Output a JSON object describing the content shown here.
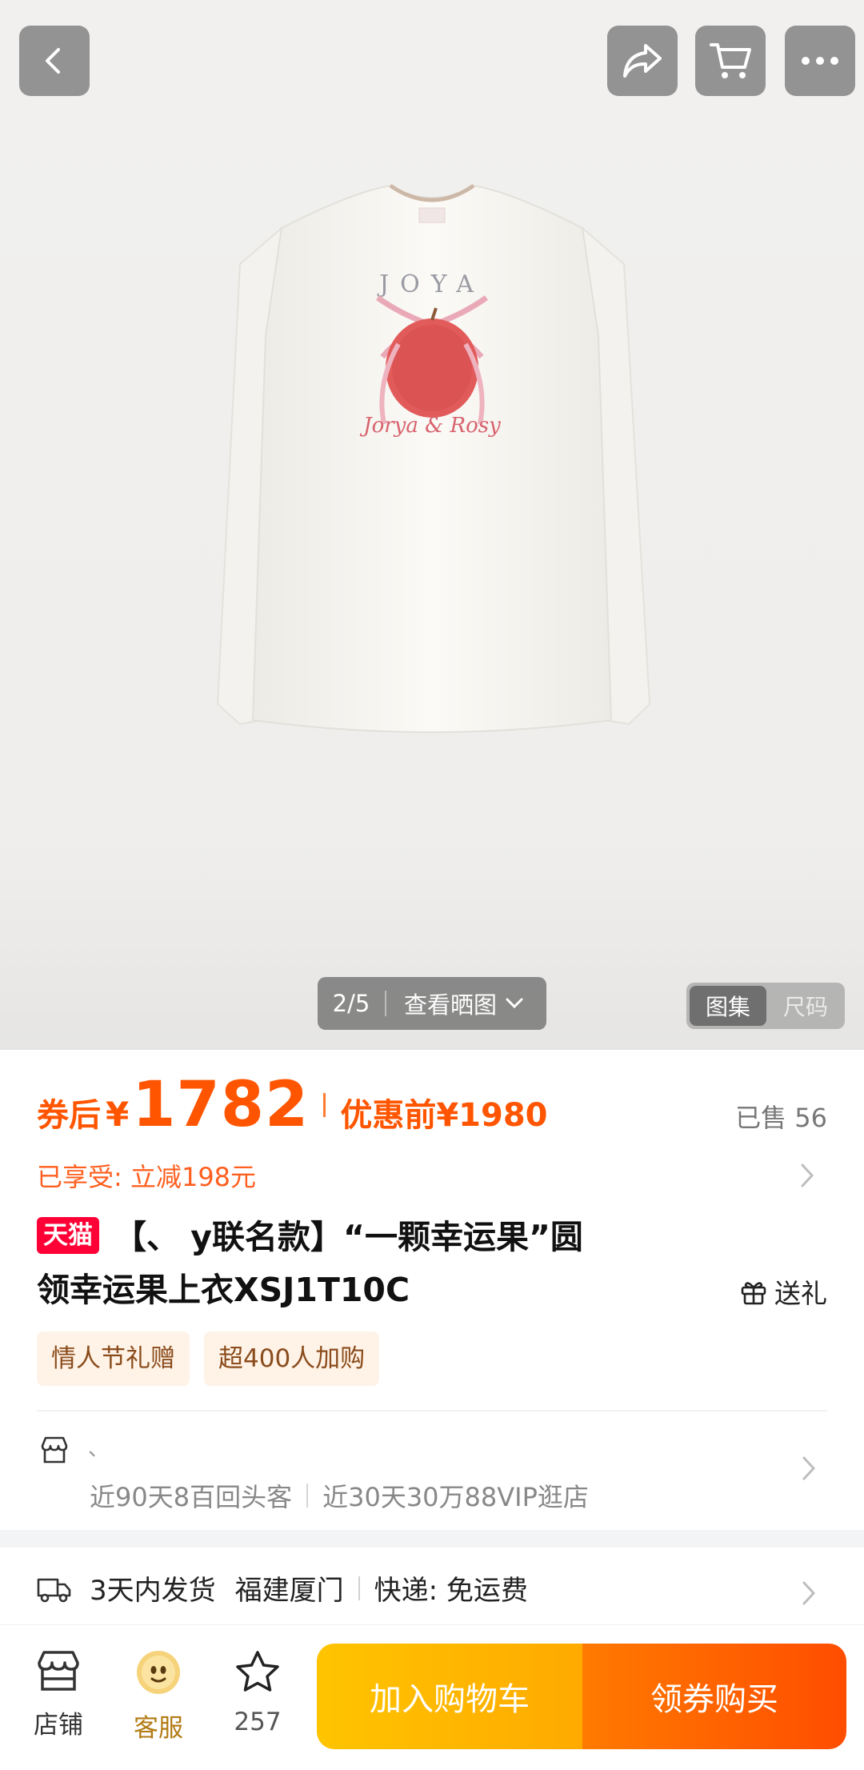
{
  "gallery": {
    "counter": "2/5",
    "view_label": "查看晒图",
    "segment_active": "图集",
    "segment_inactive": "尺码",
    "shirt_print_brand": "JOYA",
    "shirt_print_script": "Jorya & Rosy"
  },
  "price": {
    "after_label": "券后",
    "currency": "¥",
    "after_value": "1782",
    "before_label": "优惠前¥1980",
    "sold": "已售 56",
    "benefit": "已享受: 立减198元"
  },
  "product": {
    "badge": "天猫",
    "title_line1": "【、                    y联名款】“一颗幸运果”圆",
    "title_line2": "领幸运果上衣XSJ1T10C",
    "gift_label": "送礼",
    "tags": [
      "情人节礼赠",
      "超400人加购"
    ]
  },
  "shop": {
    "name": "、",
    "stat1": "近90天8百回头客",
    "stat2": "近30天30万88VIP逛店"
  },
  "shipping": {
    "time": "3天内发货",
    "origin": "福建厦门",
    "express": "快递: 免运费"
  },
  "bottom_bar": {
    "store_label": "店铺",
    "service_label": "客服",
    "fav_count": "257",
    "add_cart": "加入购物车",
    "buy": "领券购买"
  },
  "colors": {
    "accent_orange": "#ff5500",
    "tmall_red": "#ff0036",
    "cta_yellow": "#ffb300",
    "cta_orange": "#ff5a00"
  },
  "icons": [
    "back-icon",
    "share-icon",
    "cart-icon",
    "more-icon",
    "chevron-down-icon",
    "chevron-right-icon",
    "gift-icon",
    "shop-icon",
    "truck-icon",
    "store-icon",
    "service-icon",
    "star-icon"
  ]
}
